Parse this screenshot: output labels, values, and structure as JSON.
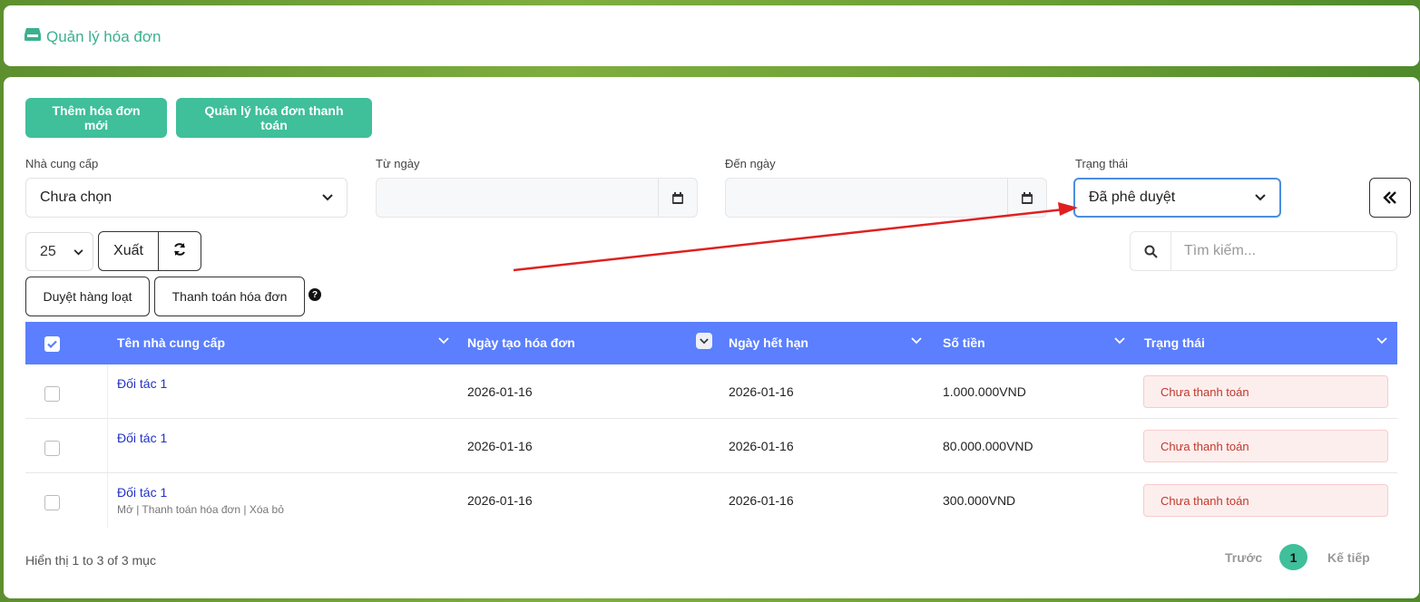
{
  "header": {
    "title": "Quản lý hóa đơn",
    "icon": "inbox-icon"
  },
  "toolbar": {
    "add_label": "Thêm hóa đơn mới",
    "manage_payment_label": "Quản lý hóa đơn thanh toán"
  },
  "filters": {
    "supplier_label": "Nhà cung cấp",
    "supplier_value": "Chưa chọn",
    "from_label": "Từ ngày",
    "to_label": "Đến ngày",
    "status_label": "Trạng thái",
    "status_value": "Đã phê duyệt"
  },
  "controls": {
    "page_size": "25",
    "export_label": "Xuất",
    "search_placeholder": "Tìm kiếm...",
    "bulk_approve_label": "Duyệt hàng loạt",
    "pay_invoice_label": "Thanh toán hóa đơn"
  },
  "table": {
    "headers": [
      "Tên nhà cung cấp",
      "Ngày tạo hóa đơn",
      "Ngày hết hạn",
      "Số tiền",
      "Trạng thái"
    ],
    "rows": [
      {
        "supplier": "Đối tác 1",
        "created": "2026-01-16",
        "due": "2026-01-16",
        "amount": "1.000.000VND",
        "status": "Chưa thanh toán"
      },
      {
        "supplier": "Đối tác 1",
        "created": "2026-01-16",
        "due": "2026-01-16",
        "amount": "80.000.000VND",
        "status": "Chưa thanh toán"
      },
      {
        "supplier": "Đối tác 1",
        "created": "2026-01-16",
        "due": "2026-01-16",
        "amount": "300.000VND",
        "status": "Chưa thanh toán",
        "actions": "Mở | Thanh toán hóa đơn | Xóa bỏ"
      }
    ]
  },
  "footer": {
    "info": "Hiển thị 1 to 3 of 3 mục",
    "prev": "Trước",
    "current_page": "1",
    "next": "Kế tiếp"
  },
  "colors": {
    "accent": "#3fbf9a",
    "table_header": "#5b7fff",
    "status_unpaid": "#c0392b",
    "annotation_arrow": "#e02020"
  }
}
